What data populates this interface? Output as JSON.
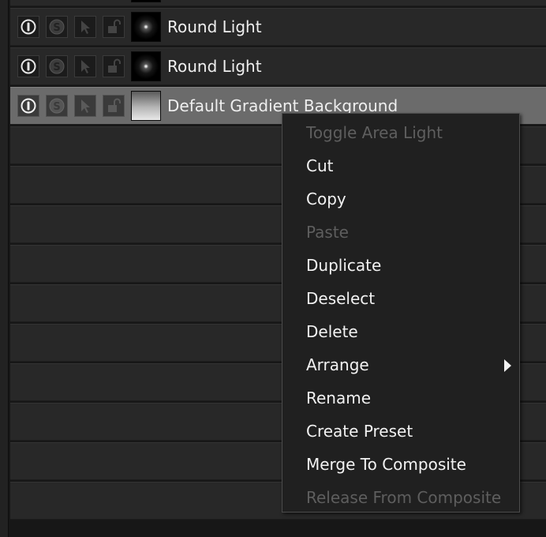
{
  "layers": [
    {
      "name": "",
      "thumbnail": "round-light"
    },
    {
      "name": "Round Light",
      "thumbnail": "round-light"
    },
    {
      "name": "Round Light",
      "thumbnail": "round-light"
    },
    {
      "name": "Default Gradient Background",
      "thumbnail": "gradient",
      "selected": true
    }
  ],
  "layer_controls": [
    "visibility-icon",
    "solo-icon",
    "select-cursor-icon",
    "lock-icon"
  ],
  "context_menu": {
    "items": [
      {
        "label": "Toggle Area Light",
        "enabled": false
      },
      {
        "label": "Cut",
        "enabled": true
      },
      {
        "label": "Copy",
        "enabled": true
      },
      {
        "label": "Paste",
        "enabled": false
      },
      {
        "label": "Duplicate",
        "enabled": true
      },
      {
        "label": "Deselect",
        "enabled": true
      },
      {
        "label": "Delete",
        "enabled": true
      },
      {
        "label": "Arrange",
        "enabled": true,
        "submenu": true
      },
      {
        "label": "Rename",
        "enabled": true
      },
      {
        "label": "Create Preset",
        "enabled": true
      },
      {
        "label": "Merge To Composite",
        "enabled": true
      },
      {
        "label": "Release From Composite",
        "enabled": false
      }
    ]
  },
  "colors": {
    "background": "#171717",
    "row": "#282828",
    "row_selected": "#6b6b6b",
    "menu_bg": "#202020",
    "text": "#f2f2f2",
    "text_disabled": "#5e5e5e"
  }
}
